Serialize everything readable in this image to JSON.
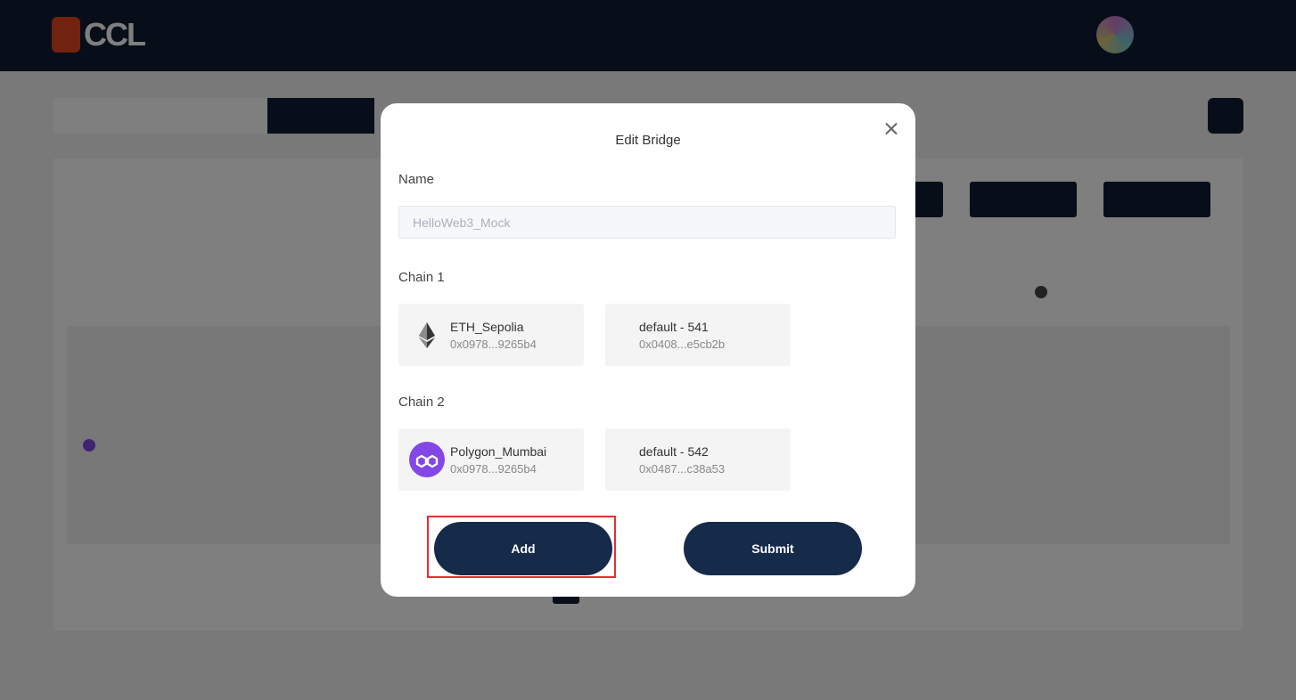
{
  "modal": {
    "title": "Edit Bridge",
    "name_label": "Name",
    "name_value": "HelloWeb3_Mock",
    "chain1_label": "Chain 1",
    "chain2_label": "Chain 2",
    "chain1": {
      "network": {
        "name": "ETH_Sepolia",
        "address": "0x0978...9265b4",
        "icon": "ethereum-icon"
      },
      "provider": {
        "name": "default - 541",
        "address": "0x0408...e5cb2b"
      }
    },
    "chain2": {
      "network": {
        "name": "Polygon_Mumbai",
        "address": "0x0978...9265b4",
        "icon": "polygon-icon"
      },
      "provider": {
        "name": "default - 542",
        "address": "0x0487...c38a53"
      }
    },
    "add_label": "Add",
    "submit_label": "Submit"
  },
  "colors": {
    "navy": "#162a4a",
    "highlight": "#e53030",
    "polygon": "#8247e5"
  }
}
